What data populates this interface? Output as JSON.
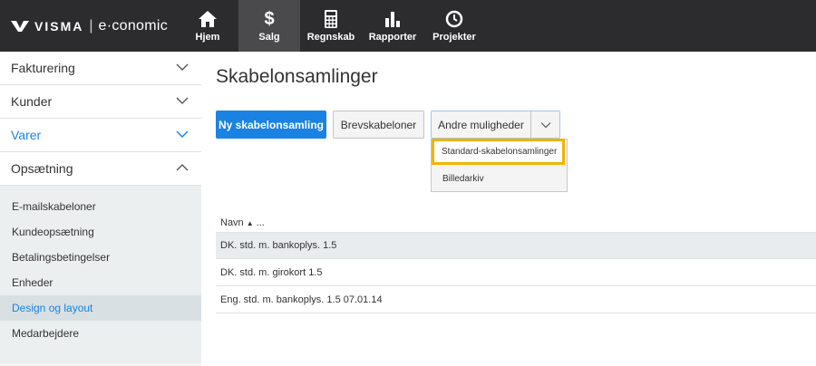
{
  "brand": {
    "name": "VISMA",
    "separator": "|",
    "product": "e·conomic"
  },
  "topnav": [
    {
      "label": "Hjem",
      "icon": "home-icon",
      "active": false
    },
    {
      "label": "Salg",
      "icon": "dollar-icon",
      "active": true
    },
    {
      "label": "Regnskab",
      "icon": "calculator-icon",
      "active": false
    },
    {
      "label": "Rapporter",
      "icon": "bar-chart-icon",
      "active": false
    },
    {
      "label": "Projekter",
      "icon": "clock-icon",
      "active": false
    }
  ],
  "sidebar": {
    "sections": [
      {
        "label": "Fakturering",
        "expanded": false
      },
      {
        "label": "Kunder",
        "expanded": false
      },
      {
        "label": "Varer",
        "expanded": false
      },
      {
        "label": "Opsætning",
        "expanded": true
      }
    ],
    "sub_items": [
      {
        "label": "E-mailskabeloner"
      },
      {
        "label": "Kundeopsætning"
      },
      {
        "label": "Betalingsbetingelser"
      },
      {
        "label": "Enheder"
      },
      {
        "label": "Design og layout",
        "active": true
      },
      {
        "label": "Medarbejdere"
      }
    ]
  },
  "main": {
    "title": "Skabelonsamlinger",
    "buttons": {
      "new": "Ny skabelonsamling",
      "letters": "Brevskabeloner",
      "more": "Andre muligheder"
    },
    "dropdown": {
      "items": [
        "Standard-skabelonsamlinger",
        "Billedarkiv"
      ]
    },
    "list": {
      "header": "Navn",
      "header_more": "...",
      "rows": [
        "DK. std. m. bankoplys. 1.5",
        "DK. std. m. girokort 1.5",
        "Eng. std. m. bankoplys. 1.5 07.01.14"
      ]
    }
  },
  "colors": {
    "topbar": "#2c2c2e",
    "accent": "#1a82e2",
    "highlight": "#f0b400"
  }
}
